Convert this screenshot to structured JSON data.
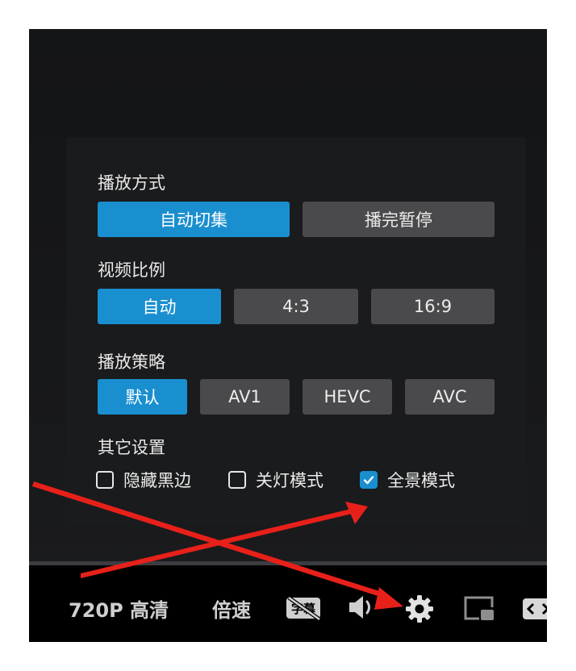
{
  "settings": {
    "play_mode": {
      "title": "播放方式",
      "options": [
        "自动切集",
        "播完暂停"
      ],
      "selected": 0
    },
    "aspect_ratio": {
      "title": "视频比例",
      "options": [
        "自动",
        "4:3",
        "16:9"
      ],
      "selected": 0
    },
    "strategy": {
      "title": "播放策略",
      "options": [
        "默认",
        "AV1",
        "HEVC",
        "AVC"
      ],
      "selected": 0
    },
    "other": {
      "title": "其它设置",
      "checkboxes": [
        {
          "label": "隐藏黑边",
          "checked": false
        },
        {
          "label": "关灯模式",
          "checked": false
        },
        {
          "label": "全景模式",
          "checked": true
        }
      ]
    }
  },
  "controls": {
    "quality": "720P 高清",
    "speed": "倍速",
    "subtitle_icon_text": "字幕"
  },
  "colors": {
    "accent": "#1a8fd0",
    "annotation_arrow": "#e8201a"
  },
  "icons": {
    "subtitle": "subtitle-off-icon",
    "volume": "volume-icon",
    "settings": "gear-icon",
    "pip": "picture-in-picture-icon",
    "widescreen": "widescreen-icon",
    "check": "check-icon"
  }
}
